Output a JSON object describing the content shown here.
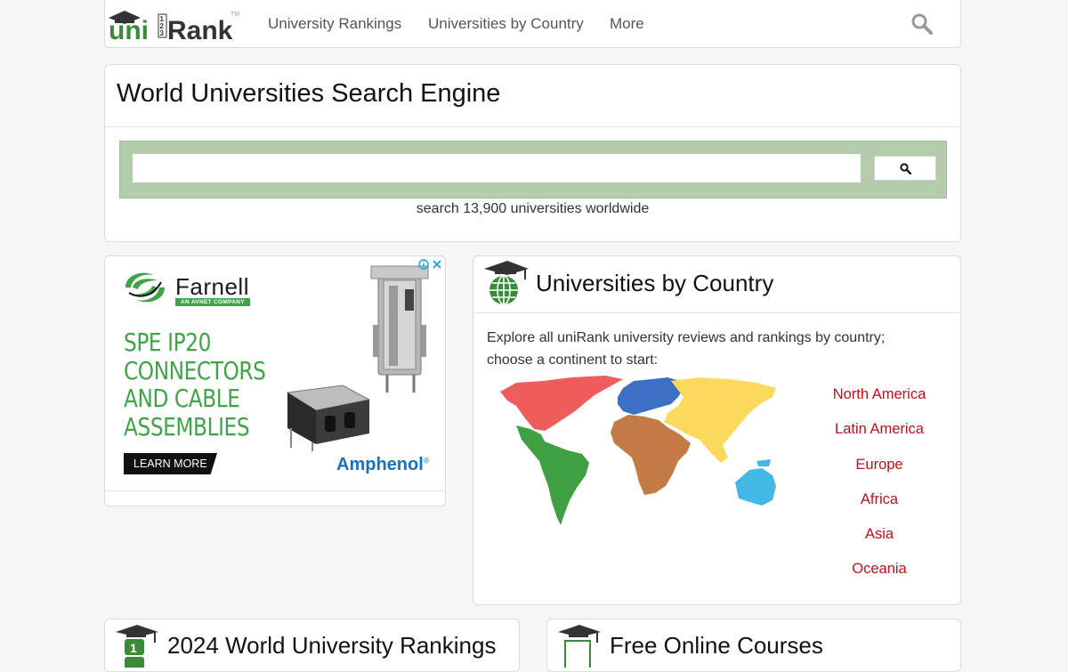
{
  "navbar": {
    "logo_text": "uniRank",
    "logo_trademark": "TM",
    "links": [
      "University Rankings",
      "Universities by Country",
      "More"
    ]
  },
  "search": {
    "title": "World Universities Search Engine",
    "placeholder": "",
    "caption": "search 13,900 universities worldwide"
  },
  "ad": {
    "brand": "Farnell",
    "brand_sub": "AN AVNET COMPANY",
    "headline": [
      "SPE IP20",
      "CONNECTORS",
      "AND CABLE",
      "ASSEMBLIES"
    ],
    "cta": "LEARN MORE",
    "partner": "Amphenol",
    "partner_mark": "®"
  },
  "countries": {
    "title": "Universities by Country",
    "description": "Explore all uniRank university reviews and rankings by country; choose a continent to start:",
    "continents": [
      "North America",
      "Latin America",
      "Europe",
      "Africa",
      "Asia",
      "Oceania"
    ]
  },
  "bottom": {
    "rankings_title": "2024 World University Rankings",
    "courses_title": "Free Online Courses"
  },
  "colors": {
    "search_box": "#b4cbac",
    "link_red": "#b8141a",
    "brand_green": "#3fa447",
    "north_america": "#ee5c5c",
    "latin_america": "#3ea043",
    "europe": "#3d6fc4",
    "africa": "#c47a45",
    "asia": "#fcd95c",
    "oceania": "#44b8e4"
  }
}
